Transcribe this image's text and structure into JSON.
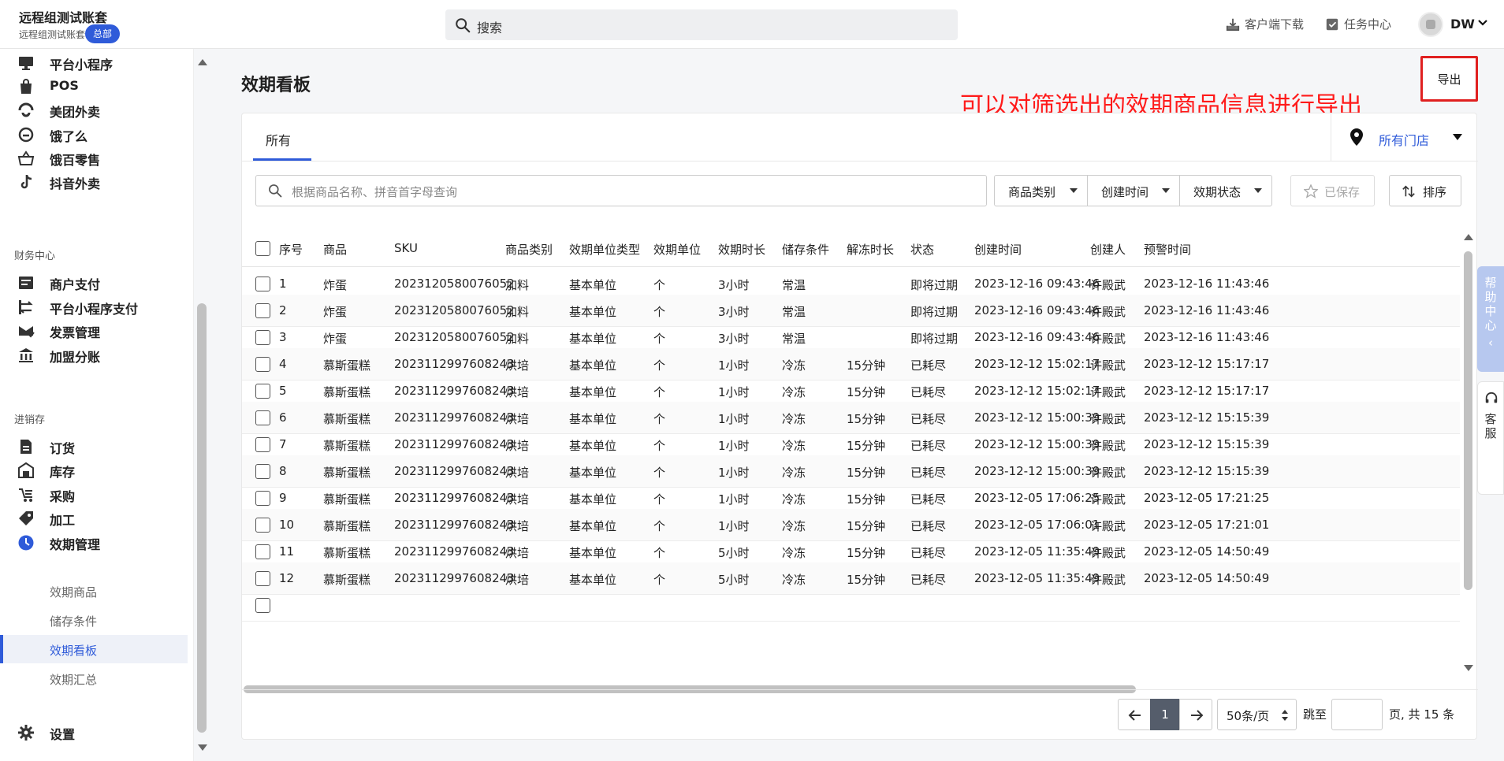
{
  "header": {
    "account_name": "远程组测试账套",
    "account_sub": "远程组测试账套",
    "account_badge": "总部",
    "search_placeholder": "搜索",
    "download_label": "客户端下载",
    "tasks_label": "任务中心",
    "user_initials": "DW"
  },
  "sidebar": {
    "top_items": [
      {
        "label": "平台小程序",
        "icon": "monitor-icon"
      },
      {
        "label": "POS",
        "icon": "shopping-bag-icon"
      },
      {
        "label": "美团外卖",
        "icon": "meituan-icon"
      },
      {
        "label": "饿了么",
        "icon": "eleme-icon"
      },
      {
        "label": "饿百零售",
        "icon": "basket-icon"
      },
      {
        "label": "抖音外卖",
        "icon": "tiktok-icon"
      }
    ],
    "finance_group": "财务中心",
    "finance_items": [
      {
        "label": "商户支付",
        "icon": "list-icon"
      },
      {
        "label": "平台小程序支付",
        "icon": "exchange-icon"
      },
      {
        "label": "发票管理",
        "icon": "invoice-icon"
      },
      {
        "label": "加盟分账",
        "icon": "bank-icon"
      }
    ],
    "inventory_group": "进销存",
    "inventory_items": [
      {
        "label": "订货",
        "icon": "document-icon"
      },
      {
        "label": "库存",
        "icon": "warehouse-icon"
      },
      {
        "label": "采购",
        "icon": "purchase-icon"
      },
      {
        "label": "加工",
        "icon": "tag-icon"
      },
      {
        "label": "效期管理",
        "icon": "clock-icon"
      }
    ],
    "sub_items": [
      "效期商品",
      "储存条件",
      "效期看板",
      "效期汇总"
    ],
    "active_sub": "效期看板",
    "settings_label": "设置"
  },
  "main": {
    "page_title": "效期看板",
    "export_label": "导出",
    "annotation": "可以对筛选出的效期商品信息进行导出",
    "tab_all": "所有",
    "store_label": "所有门店",
    "filter_placeholder": "根据商品名称、拼音首字母查询",
    "filter_category": "商品类别",
    "filter_created": "创建时间",
    "filter_status": "效期状态",
    "saved_label": "已保存",
    "sort_label": "排序"
  },
  "table": {
    "columns": [
      "序号",
      "商品",
      "SKU",
      "商品类别",
      "效期单位类型",
      "效期单位",
      "效期时长",
      "储存条件",
      "解冻时长",
      "状态",
      "创建时间",
      "创建人",
      "预警时间"
    ],
    "rows": [
      [
        "1",
        "炸蛋",
        "2023120580076052",
        "加料",
        "基本单位",
        "个",
        "3小时",
        "常温",
        "",
        "即将过期",
        "2023-12-16 09:43:46",
        "许殿武",
        "2023-12-16 11:43:46"
      ],
      [
        "2",
        "炸蛋",
        "2023120580076052",
        "加料",
        "基本单位",
        "个",
        "3小时",
        "常温",
        "",
        "即将过期",
        "2023-12-16 09:43:46",
        "许殿武",
        "2023-12-16 11:43:46"
      ],
      [
        "3",
        "炸蛋",
        "2023120580076052",
        "加料",
        "基本单位",
        "个",
        "3小时",
        "常温",
        "",
        "即将过期",
        "2023-12-16 09:43:46",
        "许殿武",
        "2023-12-16 11:43:46"
      ],
      [
        "4",
        "慕斯蛋糕",
        "2023112997608243",
        "烘培",
        "基本单位",
        "个",
        "1小时",
        "冷冻",
        "15分钟",
        "已耗尽",
        "2023-12-12 15:02:17",
        "许殿武",
        "2023-12-12 15:17:17"
      ],
      [
        "5",
        "慕斯蛋糕",
        "2023112997608243",
        "烘培",
        "基本单位",
        "个",
        "1小时",
        "冷冻",
        "15分钟",
        "已耗尽",
        "2023-12-12 15:02:17",
        "许殿武",
        "2023-12-12 15:17:17"
      ],
      [
        "6",
        "慕斯蛋糕",
        "2023112997608243",
        "烘培",
        "基本单位",
        "个",
        "1小时",
        "冷冻",
        "15分钟",
        "已耗尽",
        "2023-12-12 15:00:39",
        "许殿武",
        "2023-12-12 15:15:39"
      ],
      [
        "7",
        "慕斯蛋糕",
        "2023112997608243",
        "烘培",
        "基本单位",
        "个",
        "1小时",
        "冷冻",
        "15分钟",
        "已耗尽",
        "2023-12-12 15:00:39",
        "许殿武",
        "2023-12-12 15:15:39"
      ],
      [
        "8",
        "慕斯蛋糕",
        "2023112997608243",
        "烘培",
        "基本单位",
        "个",
        "1小时",
        "冷冻",
        "15分钟",
        "已耗尽",
        "2023-12-12 15:00:39",
        "许殿武",
        "2023-12-12 15:15:39"
      ],
      [
        "9",
        "慕斯蛋糕",
        "2023112997608243",
        "烘培",
        "基本单位",
        "个",
        "1小时",
        "冷冻",
        "15分钟",
        "已耗尽",
        "2023-12-05 17:06:25",
        "许殿武",
        "2023-12-05 17:21:25"
      ],
      [
        "10",
        "慕斯蛋糕",
        "2023112997608243",
        "烘培",
        "基本单位",
        "个",
        "1小时",
        "冷冻",
        "15分钟",
        "已耗尽",
        "2023-12-05 17:06:01",
        "许殿武",
        "2023-12-05 17:21:01"
      ],
      [
        "11",
        "慕斯蛋糕",
        "2023112997608243",
        "烘培",
        "基本单位",
        "个",
        "5小时",
        "冷冻",
        "15分钟",
        "已耗尽",
        "2023-12-05 11:35:49",
        "许殿武",
        "2023-12-05 14:50:49"
      ],
      [
        "12",
        "慕斯蛋糕",
        "2023112997608243",
        "烘培",
        "基本单位",
        "个",
        "5小时",
        "冷冻",
        "15分钟",
        "已耗尽",
        "2023-12-05 11:35:49",
        "许殿武",
        "2023-12-05 14:50:49"
      ]
    ]
  },
  "pagination": {
    "current_page": "1",
    "page_size": "50条/页",
    "jump_label": "跳至",
    "total_label": "页, 共 15 条"
  },
  "float": {
    "help_label": "帮助中心",
    "service_label": "客服"
  },
  "colors": {
    "accent": "#2f5bd9",
    "annotation": "#ff1a1a"
  }
}
